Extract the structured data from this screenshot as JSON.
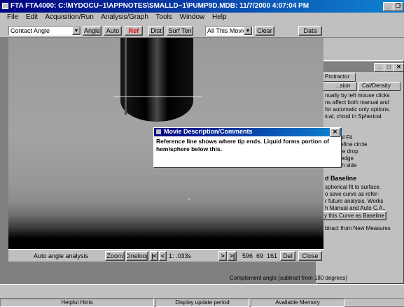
{
  "window": {
    "title": "FTA FTA4000: C:\\MYDOCU~1\\APPNOTES\\SMALLD~1\\PUMP9D.MDB: 11/7/2000 4:07:04 PM"
  },
  "menu": [
    "File",
    "Edit",
    "Acquisition/Run",
    "Analysis/Graph",
    "Tools",
    "Window",
    "Help"
  ],
  "toolbar": {
    "mode_select": "Contact Angle",
    "angle": "Angle",
    "auto": "Auto",
    "ref": "Ref",
    "dist": "Dist",
    "surf_ten": "Surf Ten",
    "movie_select": "All This Movie",
    "clear": "Clear",
    "data": "Data"
  },
  "bottom_bar": {
    "status": "Auto angle analysis",
    "zoom": "Zoom",
    "cineloop": "Cineloop",
    "first": "|<",
    "prev": "<",
    "frame": "1: .033s",
    "next": ">",
    "last": ">|",
    "readout": "596  69  161",
    "del": "Del",
    "close": "Close"
  },
  "dialog": {
    "title": "Movie Description/Comments",
    "text": "Reference line shows where tip ends.  Liquid forms portion of hemisphere below this.",
    "close": "✕"
  },
  "side_panel": {
    "tabs": [
      "Protractor",
      "...sion",
      "Cal/Density"
    ],
    "lines1": [
      "nually by left mouse clicks",
      "ns affect both manual and",
      "for automatic only options.",
      "ical, chord in Spherical."
    ],
    "lines2": [
      "pherical Fit",
      "urve define circle",
      "er entire drop",
      "single edge",
      "on each side"
    ],
    "baseline_heading": "d Baseline",
    "lines3": [
      "spherical fit to surface.",
      "o save curve as refer-",
      "r future analysis.  Works",
      "h Manual and Auto C.A.."
    ],
    "save_button": "y this Curve as Baseline",
    "subtract_line": "btract from New Measures",
    "complement": "Complement angle (subtract from 180 degrees)"
  },
  "statusbar": [
    "Helpful Hints",
    "Display update period",
    "Available Memory"
  ]
}
